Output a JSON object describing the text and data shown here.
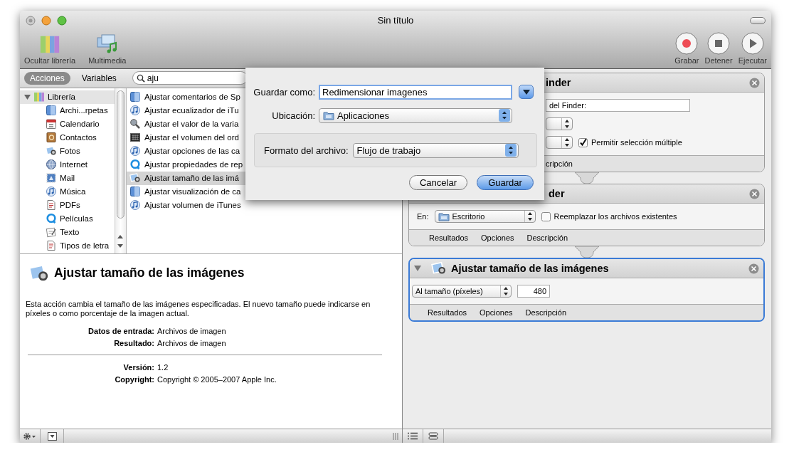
{
  "window": {
    "title": "Sin título"
  },
  "toolbar": {
    "left": [
      {
        "label": "Ocultar librería"
      },
      {
        "label": "Multimedia"
      }
    ],
    "right": [
      {
        "label": "Grabar"
      },
      {
        "label": "Detener"
      },
      {
        "label": "Ejecutar"
      }
    ]
  },
  "library_tabs": [
    {
      "label": "Acciones",
      "selected": true
    },
    {
      "label": "Variables",
      "selected": false
    }
  ],
  "search": {
    "value": "aju"
  },
  "library": {
    "label": "Librería",
    "expanded": true,
    "children": [
      {
        "label": "Archi...rpetas"
      },
      {
        "label": "Calendario"
      },
      {
        "label": "Contactos"
      },
      {
        "label": "Fotos"
      },
      {
        "label": "Internet"
      },
      {
        "label": "Mail"
      },
      {
        "label": "Música"
      },
      {
        "label": "PDFs"
      },
      {
        "label": "Películas"
      },
      {
        "label": "Texto"
      },
      {
        "label": "Tipos de letra"
      }
    ]
  },
  "actions": [
    {
      "label": "Ajustar comentarios de Sp",
      "selected": false
    },
    {
      "label": "Ajustar ecualizador de iTu",
      "selected": false
    },
    {
      "label": "Ajustar el valor de la varia",
      "selected": false
    },
    {
      "label": "Ajustar el volumen del ord",
      "selected": false
    },
    {
      "label": "Ajustar opciones de las ca",
      "selected": false
    },
    {
      "label": "Ajustar propiedades de rep",
      "selected": false
    },
    {
      "label": "Ajustar tamaño de las imá",
      "selected": true
    },
    {
      "label": "Ajustar visualización de ca",
      "selected": false
    },
    {
      "label": "Ajustar volumen de iTunes",
      "selected": false
    }
  ],
  "description": {
    "title": "Ajustar tamaño de las imágenes",
    "text": "Esta acción cambia el tamaño de las imágenes especificadas. El nuevo tamaño puede indicarse en píxeles o como porcentaje de la imagen actual.",
    "io": [
      {
        "label": "Datos de entrada:",
        "value": "Archivos de imagen"
      },
      {
        "label": "Resultado:",
        "value": "Archivos de imagen"
      }
    ],
    "meta": [
      {
        "label": "Versión:",
        "value": "1.2"
      },
      {
        "label": "Copyright:",
        "value": "Copyright © 2005–2007 Apple Inc."
      }
    ]
  },
  "workflow": {
    "cards": [
      {
        "title": "inder",
        "selected": false,
        "tabs": [
          "cripción"
        ],
        "rows": [
          {
            "kind": "field",
            "value": "del Finder:"
          },
          {
            "kind": "popup"
          },
          {
            "kind": "popup",
            "checkbox": {
              "label": "Permitir selección múltiple",
              "checked": true
            }
          }
        ]
      },
      {
        "title": "der",
        "selected": false,
        "tabs": [
          "Resultados",
          "Opciones",
          "Descripción"
        ],
        "rows": [
          {
            "kind": "popup",
            "label": "En:",
            "value": "Escritorio",
            "checkbox": {
              "label": "Reemplazar los archivos existentes",
              "checked": false
            }
          }
        ]
      },
      {
        "title": "Ajustar tamaño de las imágenes",
        "selected": true,
        "tabs": [
          "Resultados",
          "Opciones",
          "Descripción"
        ],
        "rows": [
          {
            "kind": "popup",
            "value": "Al tamaño (píxeles)",
            "field": "480"
          }
        ]
      }
    ]
  },
  "save_sheet": {
    "name_label": "Guardar como:",
    "name": "Redimensionar imagenes",
    "location_label": "Ubicación:",
    "location": "Aplicaciones",
    "format_label": "Formato del archivo:",
    "format": "Flujo de trabajo",
    "buttons": [
      {
        "label": "Cancelar",
        "default": false
      },
      {
        "label": "Guardar",
        "default": true
      }
    ]
  }
}
